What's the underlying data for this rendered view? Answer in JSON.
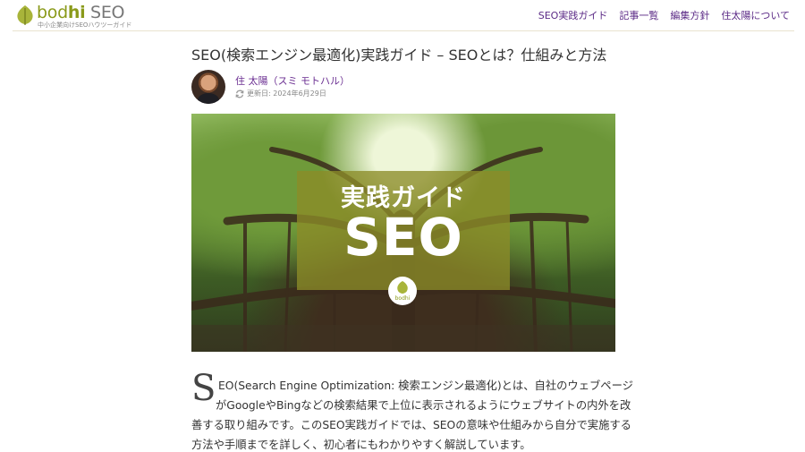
{
  "site": {
    "logo_part1": "bod",
    "logo_part2": "hi",
    "logo_part3": " SEO",
    "tagline": "中小企業向けSEOハウツーガイド",
    "brand_color": "#8a9a1a"
  },
  "nav": {
    "items": [
      "SEO実践ガイド",
      "記事一覧",
      "編集方針",
      "住太陽について"
    ],
    "link_color": "#5b2a86"
  },
  "article": {
    "title": "SEO(検索エンジン最適化)実践ガイド – SEOとは？仕組みと方法",
    "author": "住 太陽（スミ モトハル）",
    "updated_label": "更新日: 2024年6月29日",
    "hero": {
      "line1": "実践ガイド",
      "line2": "SEO",
      "logo_text": "bodhi"
    },
    "dropcap": "S",
    "lines": [
      "EO(Search Engine Optimization: 検索エンジン最適化)とは、自社のウェブページ",
      "がGoogleやBingなどの検索結果で上位に表示されるようにウェブサイトの内外を改",
      "善する取り組みです。このSEO実践ガイドでは、SEOの意味や仕組みから自分で実施する",
      "方法や手順までを詳しく、初心者にもわかりやすく解説しています。"
    ]
  }
}
